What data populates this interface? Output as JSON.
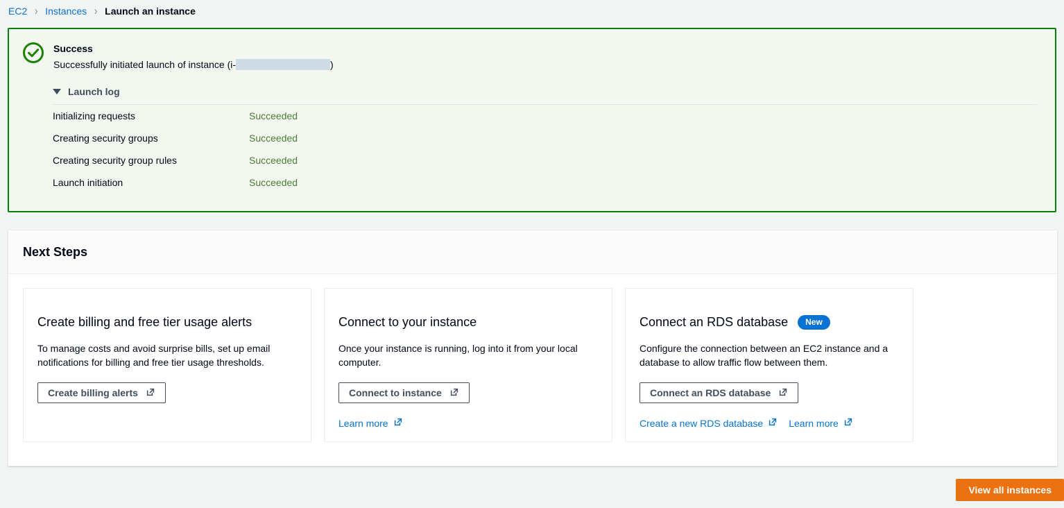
{
  "breadcrumb": {
    "items": [
      {
        "label": "EC2",
        "current": false
      },
      {
        "label": "Instances",
        "current": false
      },
      {
        "label": "Launch an instance",
        "current": true
      }
    ],
    "separator": "›"
  },
  "alert": {
    "icon": "success-check-icon",
    "title": "Success",
    "message_prefix": "Successfully initiated launch of instance (i-",
    "message_suffix": ")",
    "redacted_value": "",
    "border_color": "#037f0c",
    "background_color": "#f2f8f0"
  },
  "launch_log": {
    "toggle_label": "Launch log",
    "expanded": true,
    "rows": [
      {
        "name": "Initializing requests",
        "status": "Succeeded"
      },
      {
        "name": "Creating security groups",
        "status": "Succeeded"
      },
      {
        "name": "Creating security group rules",
        "status": "Succeeded"
      },
      {
        "name": "Launch initiation",
        "status": "Succeeded"
      }
    ],
    "status_color": "#4c7c2f"
  },
  "next_steps": {
    "title": "Next Steps",
    "cards": [
      {
        "title": "Create billing and free tier usage alerts",
        "badge": null,
        "description": "To manage costs and avoid surprise bills, set up email notifications for billing and free tier usage thresholds.",
        "button": "Create billing alerts",
        "links": []
      },
      {
        "title": "Connect to your instance",
        "badge": null,
        "description": "Once your instance is running, log into it from your local computer.",
        "button": "Connect to instance",
        "links": [
          "Learn more"
        ]
      },
      {
        "title": "Connect an RDS database",
        "badge": "New",
        "description": "Configure the connection between an EC2 instance and a database to allow traffic flow between them.",
        "button": "Connect an RDS database",
        "links": [
          "Create a new RDS database",
          "Learn more"
        ]
      }
    ]
  },
  "footer": {
    "primary_button": "View all instances",
    "primary_color": "#ec7211"
  },
  "colors": {
    "link": "#0972d3",
    "badge": "#0972d3",
    "page_background": "#f2f3f3"
  }
}
